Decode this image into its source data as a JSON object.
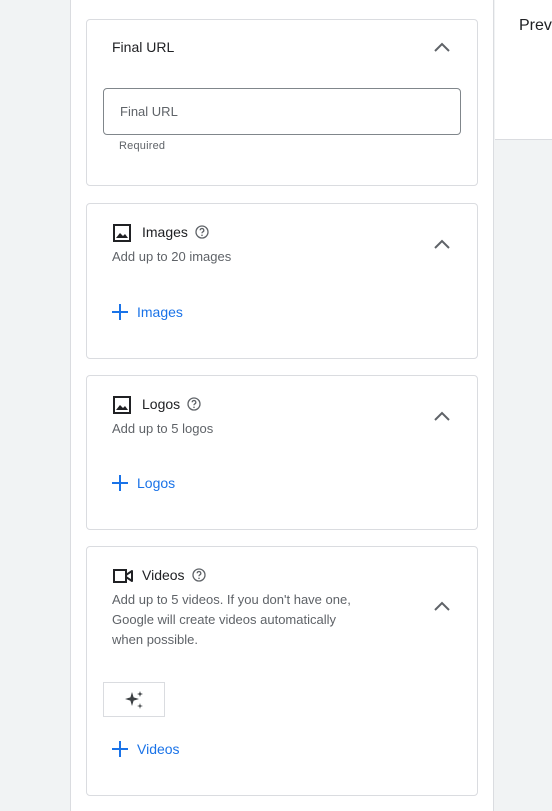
{
  "preview": {
    "title": "Prev"
  },
  "final_url": {
    "title": "Final URL",
    "input_placeholder": "Final URL",
    "input_value": "",
    "helper": "Required"
  },
  "images": {
    "title": "Images",
    "subtitle": "Add up to 20 images",
    "add_label": "Images",
    "icon": "image-icon"
  },
  "logos": {
    "title": "Logos",
    "subtitle": "Add up to 5 logos",
    "add_label": "Logos",
    "icon": "image-icon"
  },
  "videos": {
    "title": "Videos",
    "subtitle_line1": "Add up to 5 videos. If you don't have one,",
    "subtitle_line2": "Google will create videos automatically",
    "subtitle_line3": "when possible.",
    "add_label": "Videos",
    "icon": "video-camera-icon",
    "magic_icon": "sparkle-icon"
  },
  "colors": {
    "accent": "#1a73e8",
    "border": "#dadce0",
    "muted": "#5f6368"
  }
}
